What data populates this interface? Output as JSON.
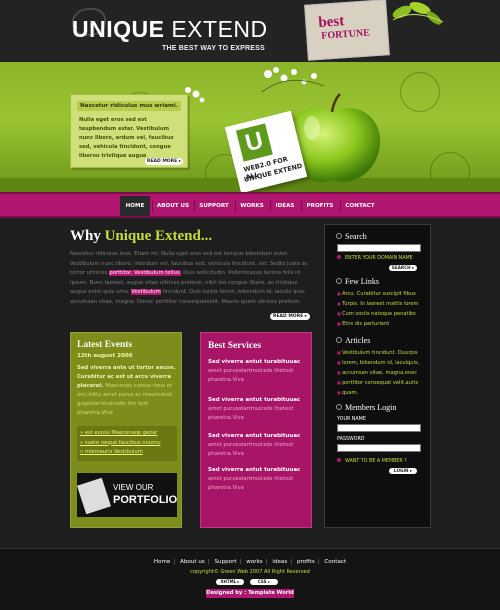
{
  "header": {
    "logo_bold": "UNIQUE",
    "logo_thin": "EXTEND",
    "tagline": "THE BEST WAY TO EXPRESS",
    "fortune_line1": "best",
    "fortune_line2": "FORTUNE"
  },
  "banner": {
    "note_title": "Nascetur ridiculus mus wriami.",
    "note_text": "Nulla eget eros sed est teupbendum ester. Vestibulum nunc libero, erdum vel, faucibus sed, vehicula tincidunt, congue liberou tristique augue",
    "note_button": "READ MORE ▸",
    "card_letter": "U",
    "card_line1": "WEB2.0 FOR ALL",
    "card_line2": "UNIQUE EXTEND"
  },
  "nav": {
    "items": [
      "HOME",
      "ABOUT US",
      "SUPPORT",
      "WORKS",
      "IDEAS",
      "PROFITS",
      "CONTACT"
    ]
  },
  "intro": {
    "heading_plain": "Why",
    "heading_hl": "Unique Extend...",
    "text_a": "Nascetur ridiculus mus. Etiam mi. Nulla eget eros sed est tempus bibendum ester. Vestibulum nunc libero, interdum vel, faucibus sed, vehicula tincidunt, est. Sedte justo ac tortor ultricies",
    "tag1": "porttitor. Vestibulum tellus.",
    "text_b": "Duis sollicitudin. Pellentesque lacinia felis id ipsum. Nunc laoreet, augue vitae ultrices pretium, nibh leo congue libero, au tristique augue enim quis urna.",
    "tag2": "Vestibulum",
    "text_c": "tincidunt. Duis turpis lorem, bibendum id, iaculis quis, accumsan vitae, magna. Donec porttitor consequatvelit. Mauris quam ultrices pretium.",
    "read_more": "READ MORE ▸"
  },
  "events": {
    "title": "Latest Events",
    "date": "12th august 2006",
    "lead": "Sed viverra ante ut tortor aecon. Curabitur ac est ut arcu viverra placerat.",
    "text": "Maecenas cursus risus et orci.isitty amet purus ac mauriciesit gogostartmuicsdis the text pharetra.Viva",
    "links": [
      "est eunisi Maecenaop gezar",
      "suere neque faucibus nnumu",
      "miemauris Vestibulum"
    ],
    "portfolio_l1": "VIEW OUR",
    "portfolio_l2": "PORTFOLIO"
  },
  "services": {
    "title": "Best Services",
    "items": [
      {
        "title": "Sed viverra antut turabituuac",
        "desc": "amet purusstartmuicsds thetext pharetra.Viva"
      },
      {
        "title": "Sed viverra antut turabituuac",
        "desc": "amet purusstartmuicsds thetext pharetra.Viva"
      },
      {
        "title": "Sed viverra antut turabituuac",
        "desc": "amet purusstartmuicsds thetext pharetra.Viva"
      },
      {
        "title": "Sed viverra antut turabituuac",
        "desc": "amet purusstartmuicsds thetext pharetra.Viva"
      }
    ]
  },
  "sidebar": {
    "search_title": "Search",
    "search_hint": "ENTER YOUR DOMAIN NAME",
    "search_button": "SEARCH ▸",
    "links_title": "Few Links",
    "links": [
      "Arcu. Curabitur suscipit fibus",
      "Turpis. In laoreet mattis lorem",
      "Cum sociis natoque penatibs",
      "Etns dis parturient"
    ],
    "articles_title": "Articles",
    "articles": [
      "Vestibulum tincidunt. Duurpis",
      "lorem, bibendum id, iaculquis,",
      "accumsan vitae, magna.onec",
      "porttitor consequat velit.auris",
      "quam."
    ],
    "login_title": "Members Login",
    "username_label": "YOUR NAME",
    "password_label": "PASSWORD",
    "member_text": "WANT TO BE A MEMBER ?",
    "login_button": "LOGIN ▸"
  },
  "footer": {
    "links": [
      "Home",
      "About us",
      "Support",
      "works",
      "ideas",
      "profits",
      "Contact"
    ],
    "copyright": "copyright© Green Web 2007 All Right Reserved",
    "badge1": "XHTML ▸",
    "badge2": "CSS ▸",
    "designed_by": "Designed by : Template World"
  },
  "colors": {
    "accent_green": "#c6dd3e",
    "accent_magenta": "#b01570",
    "background": "#1e1e1e"
  }
}
